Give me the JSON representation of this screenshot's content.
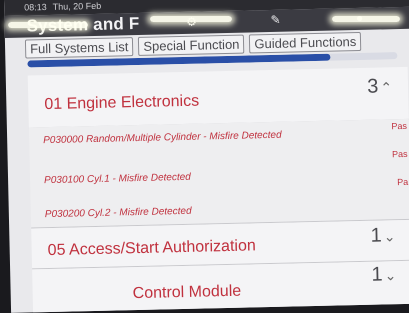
{
  "status": {
    "time": "08:13",
    "date": "Thu, 20 Feb"
  },
  "header": {
    "title": "System and F"
  },
  "icons": [
    "settings-icon",
    "edit-icon",
    "person-icon"
  ],
  "tabs": [
    {
      "label": "Full Systems List"
    },
    {
      "label": "Special Function"
    },
    {
      "label": "Guided Functions"
    }
  ],
  "progress": {
    "fraction": 0.82
  },
  "systems": [
    {
      "label": "01 Engine Electronics",
      "count": "3"
    },
    {
      "label": "05 Access/Start Authorization",
      "count": "1"
    },
    {
      "label": "Control Module",
      "count": "1"
    }
  ],
  "dtcs": [
    {
      "code": "P030000 Random/Multiple Cylinder - Misfire Detected",
      "status": "Pas"
    },
    {
      "code": "P030100 Cyl.1 - Misfire Detected",
      "status": "Pas"
    },
    {
      "code": "P030200 Cyl.2 - Misfire Detected",
      "status": "Pa"
    }
  ],
  "colors": {
    "accent": "#2a4fa7",
    "error": "#c0313e"
  }
}
